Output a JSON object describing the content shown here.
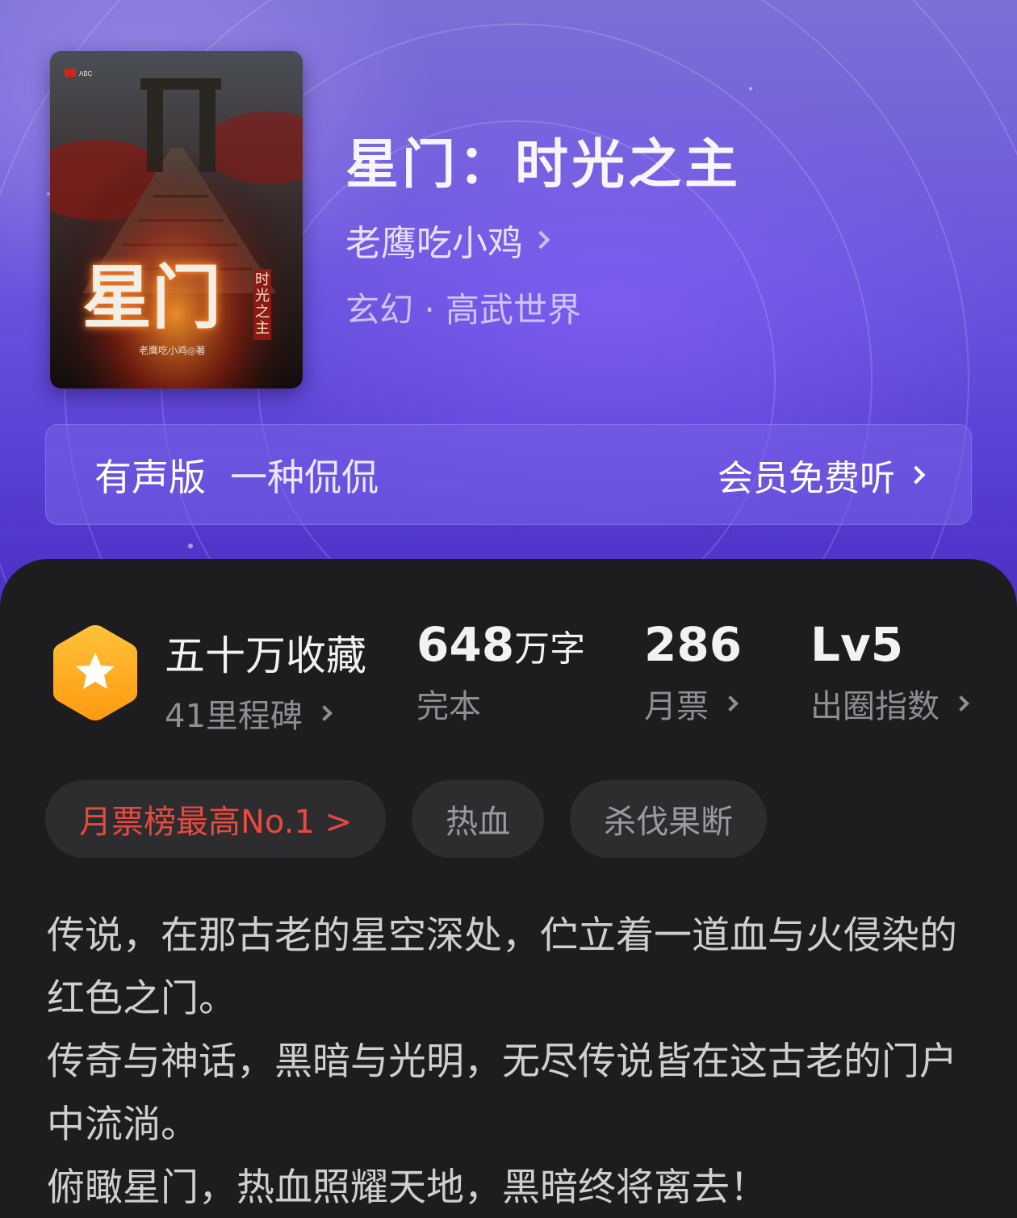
{
  "book": {
    "title": "星门：时光之主",
    "author": "老鹰吃小鸡",
    "genre": "玄幻 · 高武世界",
    "cover": {
      "title_big": "星门",
      "subtitle": "时光之主",
      "author_line": "老鹰吃小鸡◎著"
    }
  },
  "audio": {
    "label": "有声版",
    "narrator": "一种侃侃",
    "cta": "会员免费听"
  },
  "stats": {
    "favorites": {
      "value": "五十万收藏",
      "sub": "41里程碑"
    },
    "words": {
      "value": "648",
      "unit": "万字",
      "sub": "完本"
    },
    "votes": {
      "value": "286",
      "sub": "月票"
    },
    "index": {
      "value": "Lv5",
      "sub": "出圈指数"
    }
  },
  "tags": [
    "月票榜最高No.1 >",
    "热血",
    "杀伐果断"
  ],
  "description": [
    "传说，在那古老的星空深处，伫立着一道血与火侵染的红色之门。",
    "传奇与神话，黑暗与光明，无尽传说皆在这古老的门户中流淌。",
    "俯瞰星门，热血照耀天地，黑暗终将离去！"
  ],
  "colors": {
    "header_purple": "#5a3fd6",
    "card_bg": "#1d1d1f",
    "badge_orange": "#ffb020",
    "rank_red": "#e84a3f"
  },
  "icons": [
    "star-badge-icon",
    "chevron-right-icon"
  ]
}
